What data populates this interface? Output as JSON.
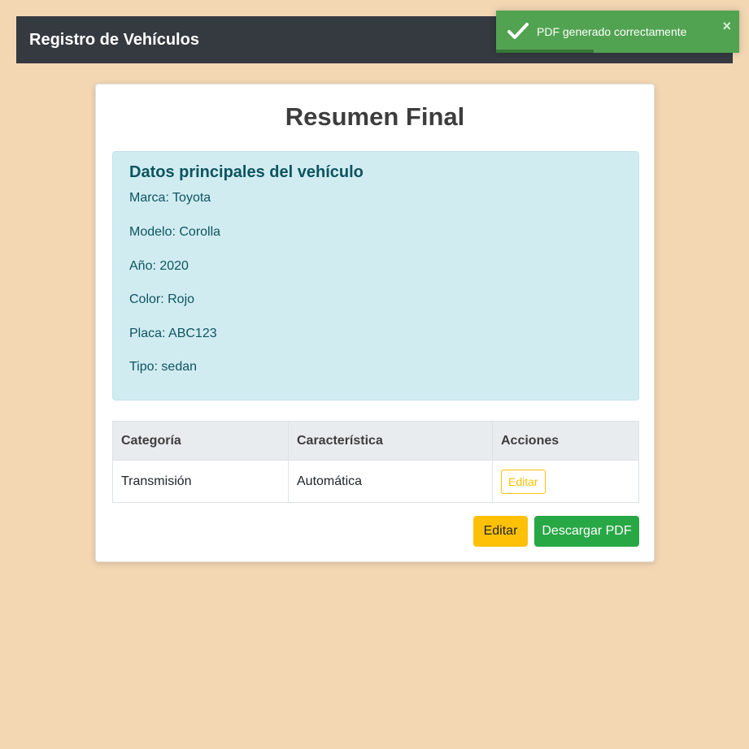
{
  "navbar": {
    "title": "Registro de Vehículos"
  },
  "card": {
    "title": "Resumen Final",
    "info": {
      "heading": "Datos principales del vehículo",
      "lines": [
        "Marca: Toyota",
        "Modelo: Corolla",
        "Año: 2020",
        "Color: Rojo",
        "Placa: ABC123",
        "Tipo: sedan"
      ]
    },
    "table": {
      "headers": [
        "Categoría",
        "Característica",
        "Acciones"
      ],
      "rows": [
        {
          "category": "Transmisión",
          "feature": "Automática",
          "action_label": "Editar"
        }
      ]
    },
    "buttons": {
      "edit_label": "Editar",
      "download_label": "Descargar PDF"
    }
  },
  "toast": {
    "message": "PDF generado correctamente",
    "close_label": "×",
    "progress": 0.4
  },
  "colors": {
    "background": "#f3d7b3",
    "navbar": "#343a40",
    "info_bg": "#d1ecf1",
    "warning": "#ffc107",
    "success": "#28a745",
    "toast": "#51a351"
  },
  "icons": {
    "toast": "check-icon"
  }
}
